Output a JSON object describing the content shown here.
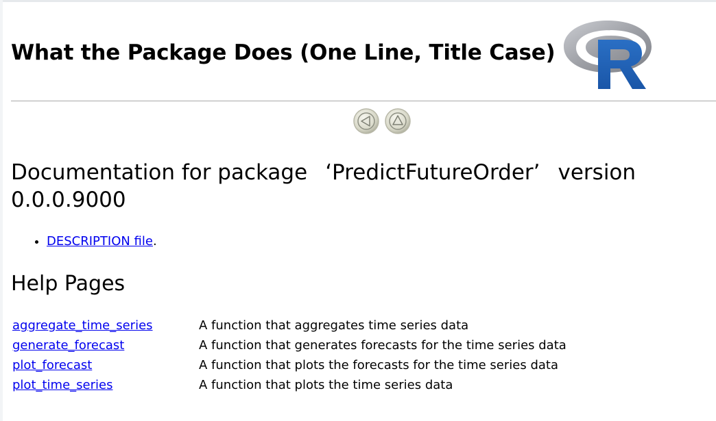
{
  "header": {
    "title": "What the Package Does (One Line, Title Case)",
    "logo_icon": "r-logo-icon",
    "logo_colors": {
      "ring": "#9a9ca3",
      "letter": "#1c5fb4"
    }
  },
  "nav": {
    "back_icon": "left-arrow-circle-icon",
    "up_icon": "up-arrow-circle-icon"
  },
  "doc": {
    "prefix": "Documentation for package",
    "package": "‘PredictFutureOrder’",
    "version_label": "version",
    "version": "0.0.0.9000",
    "description_link": "DESCRIPTION file",
    "description_suffix": "."
  },
  "help": {
    "heading": "Help Pages",
    "rows": [
      {
        "name": "aggregate_time_series",
        "desc": "A function that aggregates time series data"
      },
      {
        "name": "generate_forecast",
        "desc": "A function that generates forecasts for the time series data"
      },
      {
        "name": "plot_forecast",
        "desc": "A function that plots the forecasts for the time series data"
      },
      {
        "name": "plot_time_series",
        "desc": "A function that plots the time series data"
      }
    ]
  },
  "colors": {
    "link": "#0000ee",
    "rule": "#a9a9a9"
  }
}
